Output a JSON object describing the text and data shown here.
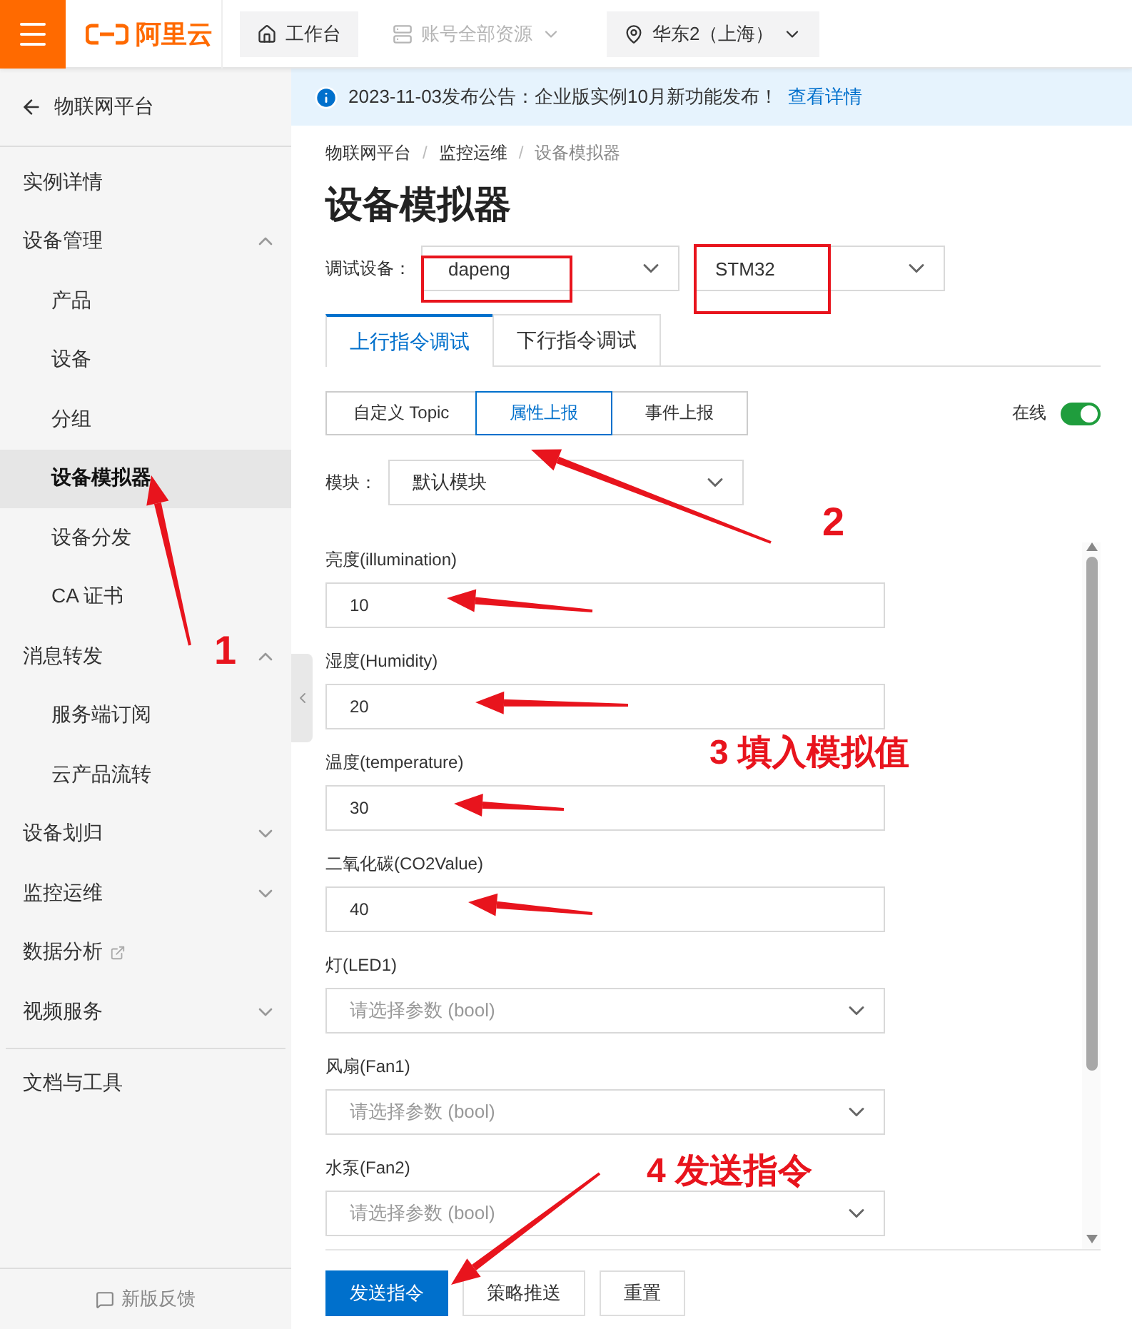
{
  "topbar": {
    "logo": "阿里云",
    "nav": [
      {
        "label": "工作台",
        "kind": "home",
        "disabled": false,
        "dropdown": false
      },
      {
        "label": "账号全部资源",
        "kind": "resources",
        "disabled": true,
        "dropdown": true
      },
      {
        "label": "华东2（上海）",
        "kind": "region",
        "disabled": false,
        "dropdown": true
      }
    ]
  },
  "sidebar": {
    "back": "物联网平台",
    "items": [
      {
        "label": "实例详情",
        "kind": "link",
        "selected": false
      },
      {
        "label": "设备管理",
        "kind": "group",
        "expanded": true,
        "children": [
          {
            "label": "产品",
            "selected": false
          },
          {
            "label": "设备",
            "selected": false
          },
          {
            "label": "分组",
            "selected": false
          },
          {
            "label": "设备模拟器",
            "selected": true
          },
          {
            "label": "设备分发",
            "selected": false
          },
          {
            "label": "CA 证书",
            "selected": false
          }
        ]
      },
      {
        "label": "消息转发",
        "kind": "group",
        "expanded": true,
        "children": [
          {
            "label": "服务端订阅",
            "selected": false
          },
          {
            "label": "云产品流转",
            "selected": false
          }
        ]
      },
      {
        "label": "设备划归",
        "kind": "group",
        "expanded": false
      },
      {
        "label": "监控运维",
        "kind": "group",
        "expanded": false
      },
      {
        "label": "数据分析",
        "kind": "external",
        "selected": false
      },
      {
        "label": "视频服务",
        "kind": "group",
        "expanded": false
      },
      {
        "label": "文档与工具",
        "kind": "link",
        "selected": false,
        "divider_before": true
      }
    ],
    "footer": "新版反馈"
  },
  "notice": {
    "text": "2023-11-03发布公告：企业版实例10月新功能发布！",
    "link": "查看详情"
  },
  "breadcrumb": {
    "separator": "/",
    "items": [
      "物联网平台",
      "监控运维",
      "设备模拟器"
    ]
  },
  "title": "设备模拟器",
  "device": {
    "label": "调试设备：",
    "selects": [
      "dapeng",
      "STM32"
    ]
  },
  "tabs": [
    {
      "label": "上行指令调试",
      "selected": true
    },
    {
      "label": "下行指令调试",
      "selected": false
    }
  ],
  "subtabs": [
    {
      "label": "自定义 Topic",
      "selected": false
    },
    {
      "label": "属性上报",
      "selected": true
    },
    {
      "label": "事件上报",
      "selected": false
    }
  ],
  "status": {
    "label": "在线",
    "on": true
  },
  "module": {
    "label": "模块：",
    "value": "默认模块"
  },
  "fields": [
    {
      "label": "亮度(illumination)",
      "kind": "input",
      "value": "10"
    },
    {
      "label": "湿度(Humidity)",
      "kind": "input",
      "value": "20"
    },
    {
      "label": "温度(temperature)",
      "kind": "input",
      "value": "30"
    },
    {
      "label": "二氧化碳(CO2Value)",
      "kind": "input",
      "value": "40"
    },
    {
      "label": "灯(LED1)",
      "kind": "select",
      "placeholder": "请选择参数 (bool)"
    },
    {
      "label": "风扇(Fan1)",
      "kind": "select",
      "placeholder": "请选择参数 (bool)"
    },
    {
      "label": "水泵(Fan2)",
      "kind": "select",
      "placeholder": "请选择参数 (bool)"
    }
  ],
  "buttons": [
    {
      "label": "发送指令",
      "kind": "primary"
    },
    {
      "label": "策略推送",
      "kind": "default"
    },
    {
      "label": "重置",
      "kind": "default"
    }
  ],
  "annotations": [
    "1",
    "2",
    "3 填入模拟值",
    "4 发送指令"
  ]
}
